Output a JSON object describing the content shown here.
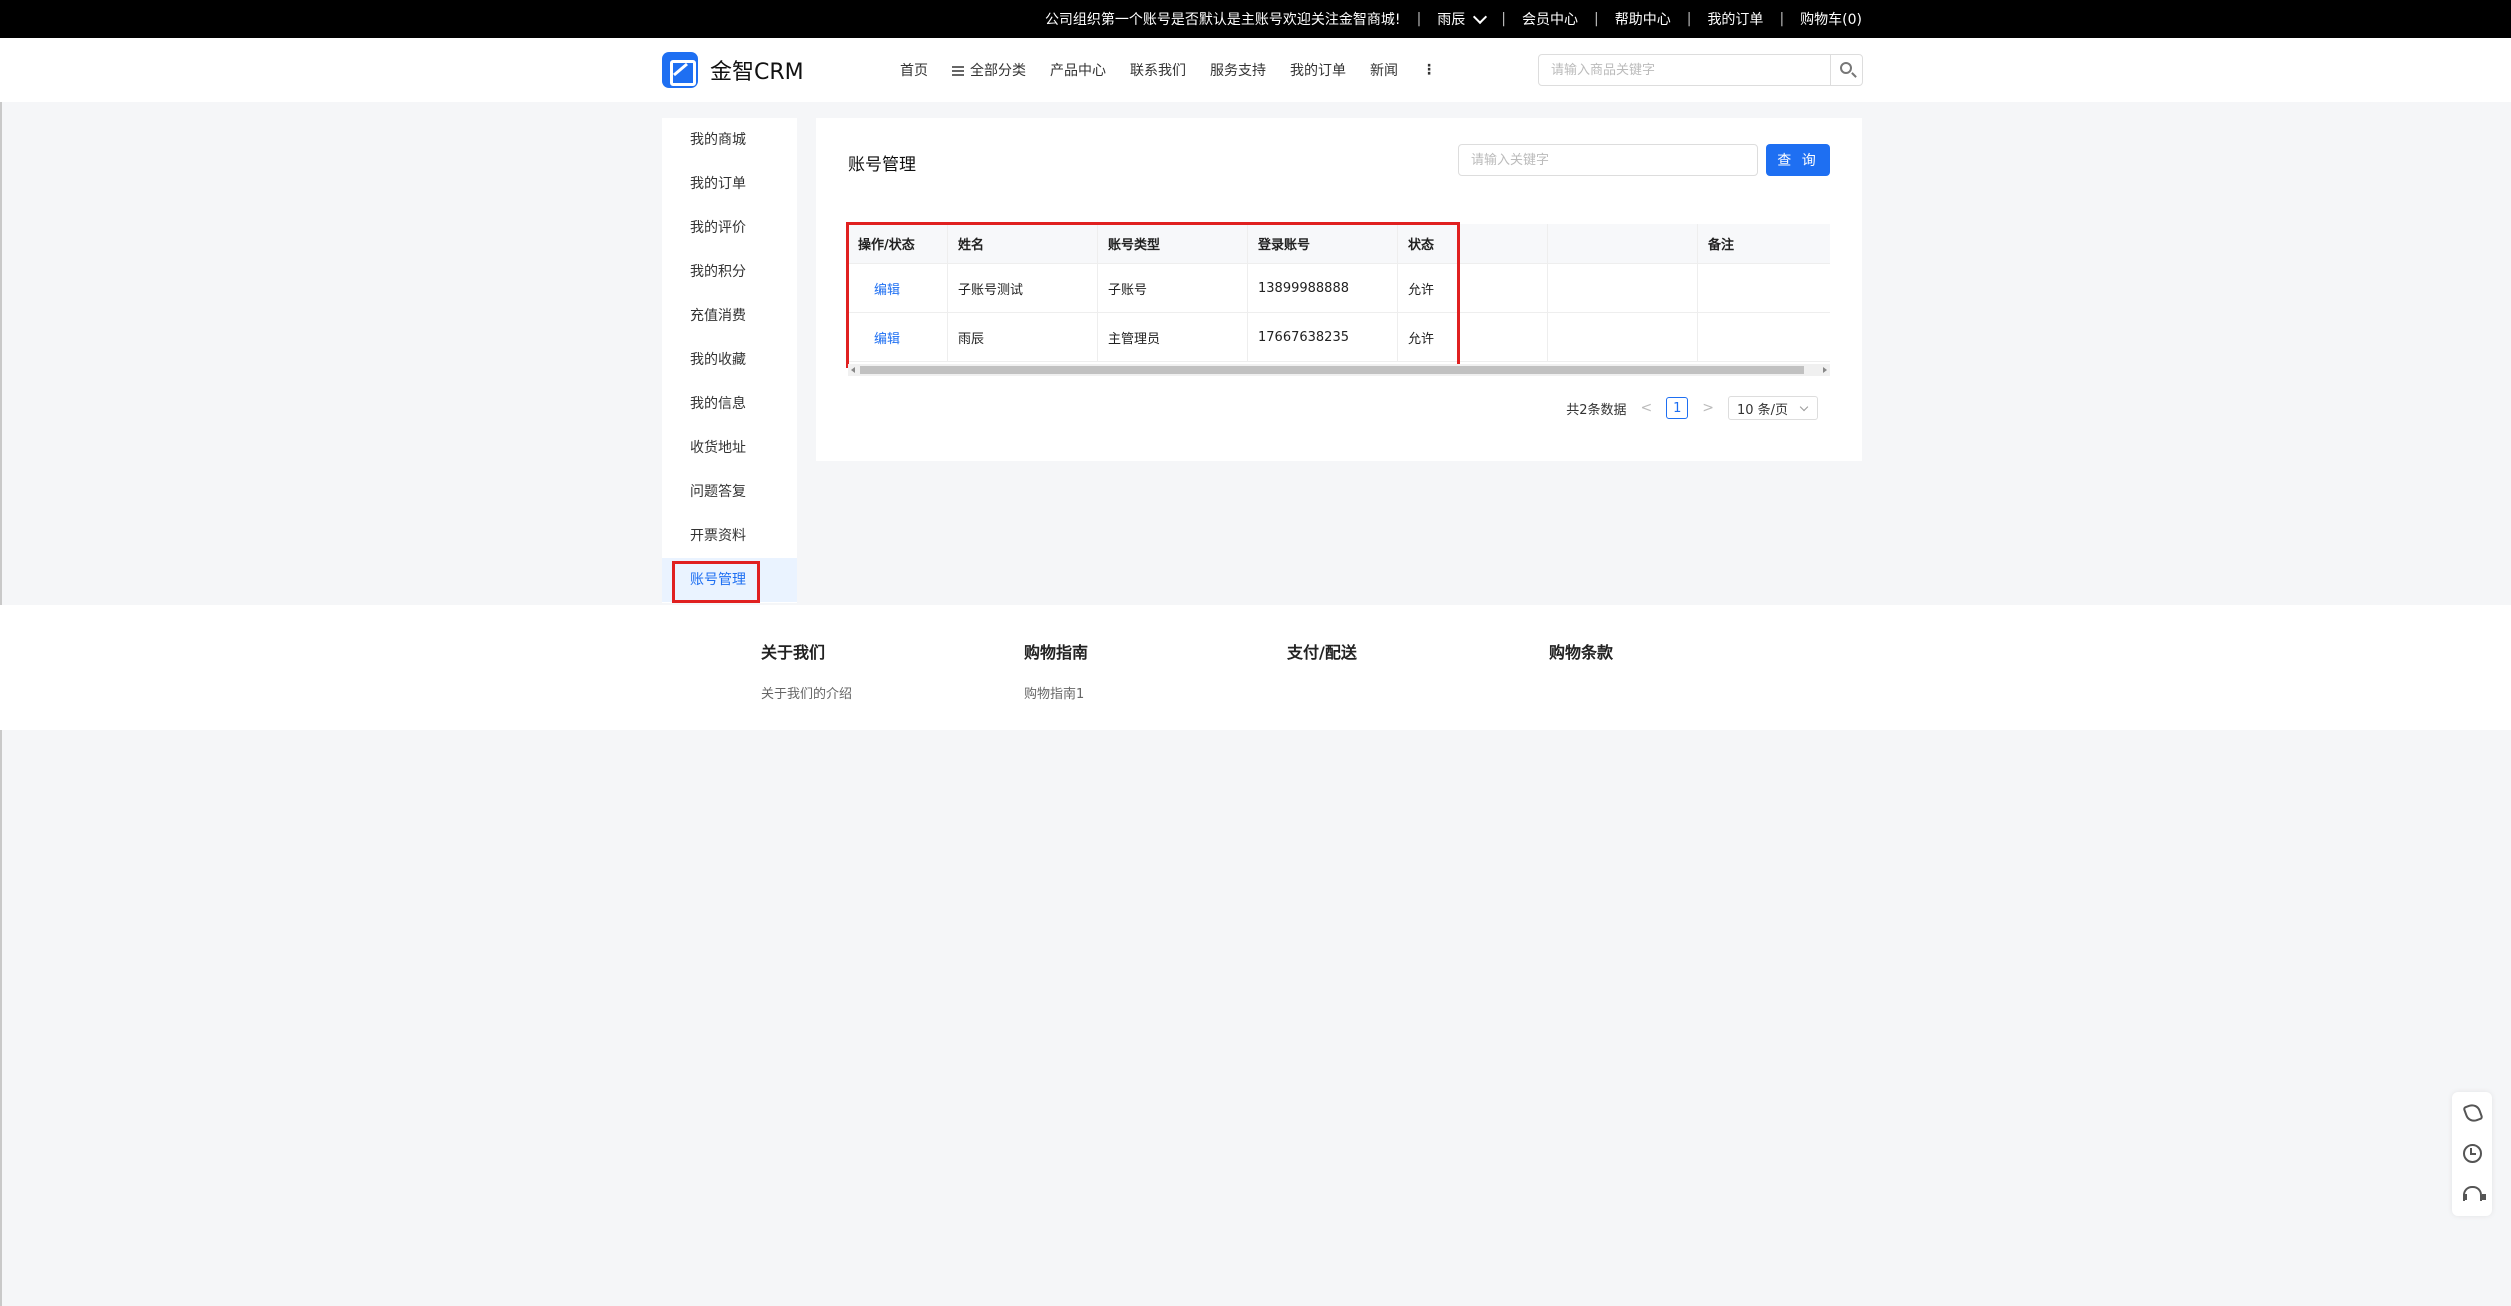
{
  "topbar": {
    "notice": "公司组织第一个账号是否默认是主账号欢迎关注金智商城!",
    "user": "雨辰",
    "links": [
      "会员中心",
      "帮助中心",
      "我的订单",
      "购物车(0)"
    ]
  },
  "header": {
    "logo_text": "金智CRM",
    "nav": [
      "首页",
      "全部分类",
      "产品中心",
      "联系我们",
      "服务支持",
      "我的订单",
      "新闻"
    ],
    "more": "⋮",
    "search_placeholder": "请输入商品关键字"
  },
  "sidebar": {
    "items": [
      "我的商城",
      "我的订单",
      "我的评价",
      "我的积分",
      "充值消费",
      "我的收藏",
      "我的信息",
      "收货地址",
      "问题答复",
      "开票资料",
      "账号管理"
    ],
    "active": "账号管理"
  },
  "main": {
    "title": "账号管理",
    "search_placeholder": "请输入关键字",
    "query_button": "查 询",
    "table": {
      "headers": [
        "操作/状态",
        "姓名",
        "账号类型",
        "登录账号",
        "状态",
        "",
        "备注"
      ],
      "rows": [
        {
          "action": "编辑",
          "name": "子账号测试",
          "type": "子账号",
          "login": "13899988888",
          "status": "允许",
          "extra": "",
          "remark": ""
        },
        {
          "action": "编辑",
          "name": "雨辰",
          "type": "主管理员",
          "login": "17667638235",
          "status": "允许",
          "extra": "",
          "remark": ""
        }
      ]
    },
    "pager": {
      "total": "共2条数据",
      "prev": "<",
      "current": "1",
      "next": ">",
      "page_size": "10 条/页"
    }
  },
  "footer": {
    "columns": [
      {
        "title": "关于我们",
        "link": "关于我们的介绍"
      },
      {
        "title": "购物指南",
        "link": "购物指南1"
      },
      {
        "title": "支付/配送",
        "link": ""
      },
      {
        "title": "购物条款",
        "link": ""
      }
    ]
  },
  "colors": {
    "accent": "#1e6ff2",
    "highlight": "#e02020"
  }
}
